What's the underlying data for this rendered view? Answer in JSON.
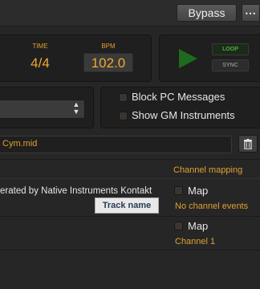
{
  "toolbar": {
    "bypass_label": "Bypass",
    "more_label": "⋯",
    "more_icon": "ellipsis-icon"
  },
  "transport": {
    "time_label": "TIME",
    "time_value": "4/4",
    "bpm_label": "BPM",
    "bpm_value": "102.0",
    "play_icon": "play-icon",
    "loop_label": "LOOP",
    "sync_label": "SYNC"
  },
  "settings": {
    "dropdown_value": "",
    "block_pc_label": "Block PC Messages",
    "show_gm_label": "Show GM Instruments"
  },
  "file": {
    "name": "Cym.mid",
    "trash_icon": "trash-icon"
  },
  "mapping": {
    "header": "Channel mapping",
    "tracks": [
      {
        "text": "erated by Native Instruments Kontakt",
        "map_label": "Map",
        "status": "No channel events"
      },
      {
        "text": "",
        "map_label": "Map",
        "status": "Channel 1"
      }
    ],
    "tooltip": "Track name"
  },
  "colors": {
    "accent": "#e0a030",
    "loop_green": "#4caf3a",
    "play_green": "#1f6a1f",
    "background": "#262626"
  }
}
